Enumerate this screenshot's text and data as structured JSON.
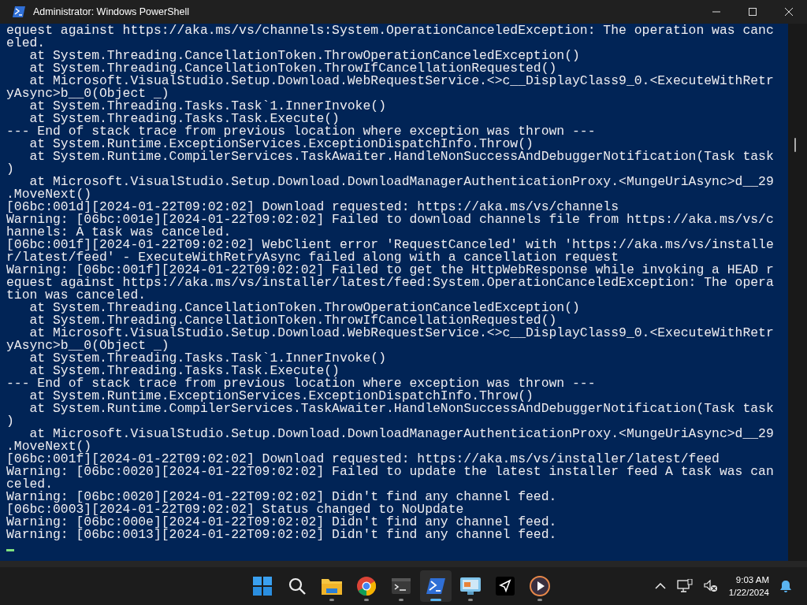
{
  "window": {
    "title": "Administrator: Windows PowerShell"
  },
  "console": {
    "lines": [
      "equest against https://aka.ms/vs/channels:System.OperationCanceledException: The operation was canc",
      "eled.",
      "   at System.Threading.CancellationToken.ThrowOperationCanceledException()",
      "   at System.Threading.CancellationToken.ThrowIfCancellationRequested()",
      "   at Microsoft.VisualStudio.Setup.Download.WebRequestService.<>c__DisplayClass9_0.<ExecuteWithRetr",
      "yAsync>b__0(Object _)",
      "   at System.Threading.Tasks.Task`1.InnerInvoke()",
      "   at System.Threading.Tasks.Task.Execute()",
      "--- End of stack trace from previous location where exception was thrown ---",
      "   at System.Runtime.ExceptionServices.ExceptionDispatchInfo.Throw()",
      "   at System.Runtime.CompilerServices.TaskAwaiter.HandleNonSuccessAndDebuggerNotification(Task task",
      ")",
      "   at Microsoft.VisualStudio.Setup.Download.DownloadManagerAuthenticationProxy.<MungeUriAsync>d__29",
      ".MoveNext()",
      "[06bc:001d][2024-01-22T09:02:02] Download requested: https://aka.ms/vs/channels",
      "Warning: [06bc:001e][2024-01-22T09:02:02] Failed to download channels file from https://aka.ms/vs/c",
      "hannels: A task was canceled.",
      "[06bc:001f][2024-01-22T09:02:02] WebClient error 'RequestCanceled' with 'https://aka.ms/vs/installe",
      "r/latest/feed' - ExecuteWithRetryAsync failed along with a cancellation request",
      "Warning: [06bc:001f][2024-01-22T09:02:02] Failed to get the HttpWebResponse while invoking a HEAD r",
      "equest against https://aka.ms/vs/installer/latest/feed:System.OperationCanceledException: The opera",
      "tion was canceled.",
      "   at System.Threading.CancellationToken.ThrowOperationCanceledException()",
      "   at System.Threading.CancellationToken.ThrowIfCancellationRequested()",
      "   at Microsoft.VisualStudio.Setup.Download.WebRequestService.<>c__DisplayClass9_0.<ExecuteWithRetr",
      "yAsync>b__0(Object _)",
      "   at System.Threading.Tasks.Task`1.InnerInvoke()",
      "   at System.Threading.Tasks.Task.Execute()",
      "--- End of stack trace from previous location where exception was thrown ---",
      "   at System.Runtime.ExceptionServices.ExceptionDispatchInfo.Throw()",
      "   at System.Runtime.CompilerServices.TaskAwaiter.HandleNonSuccessAndDebuggerNotification(Task task",
      ")",
      "   at Microsoft.VisualStudio.Setup.Download.DownloadManagerAuthenticationProxy.<MungeUriAsync>d__29",
      ".MoveNext()",
      "[06bc:001f][2024-01-22T09:02:02] Download requested: https://aka.ms/vs/installer/latest/feed",
      "Warning: [06bc:0020][2024-01-22T09:02:02] Failed to update the latest installer feed A task was can",
      "celed.",
      "Warning: [06bc:0020][2024-01-22T09:02:02] Didn't find any channel feed.",
      "[06bc:0003][2024-01-22T09:02:02] Status changed to NoUpdate",
      "Warning: [06bc:000e][2024-01-22T09:02:02] Didn't find any channel feed.",
      "Warning: [06bc:0013][2024-01-22T09:02:02] Didn't find any channel feed."
    ]
  },
  "taskbar": {
    "apps": [
      {
        "running": false,
        "selected": false
      },
      {
        "running": false,
        "selected": false
      },
      {
        "running": true,
        "selected": false
      },
      {
        "running": true,
        "selected": false
      },
      {
        "running": true,
        "selected": false
      },
      {
        "running": true,
        "selected": true
      },
      {
        "running": true,
        "selected": false
      },
      {
        "running": false,
        "selected": false
      },
      {
        "running": true,
        "selected": false
      }
    ],
    "time": "9:03 AM",
    "date": "1/22/2024"
  }
}
